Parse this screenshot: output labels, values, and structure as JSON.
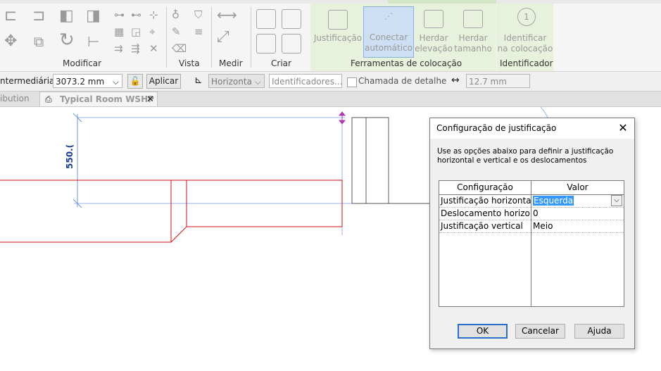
{
  "ribbon": {
    "panels": {
      "modificar": "Modificar",
      "vista": "Vista",
      "medir": "Medir",
      "criar": "Criar",
      "ferramentas": "Ferramentas de colocação",
      "identificador": "Identificador"
    },
    "buttons": {
      "justificacao": "Justificação",
      "conectar_line1": "Conectar",
      "conectar_line2": "automático",
      "herdar_elev_line1": "Herdar",
      "herdar_elev_line2": "elevação",
      "herdar_tam_line1": "Herdar",
      "herdar_tam_line2": "tamanho",
      "identificar_line1": "Identificar",
      "identificar_line2": "na colocação"
    }
  },
  "optbar": {
    "intermediaria_label": "ntermediária:",
    "intermediaria_value": "3073.2 mm",
    "aplicar": "Aplicar",
    "orientation_value": "Horizonta",
    "identificadores_placeholder": "Identificadores...",
    "chamada_label": "Chamada de detalhe",
    "offset_value": "12.7 mm"
  },
  "tabs": {
    "prev_tab": "ibution",
    "active_tab": "Typical Room WSHP"
  },
  "canvas": {
    "dimension_label": "550.("
  },
  "dialog": {
    "title": "Configuração de justificação",
    "description": "Use as opções abaixo para definir a justificação horizontal e vertical e os deslocamentos",
    "grid": {
      "col_config": "Configuração",
      "col_valor": "Valor",
      "rows": [
        {
          "config": "Justificação horizontal",
          "valor": "Esquerda"
        },
        {
          "config": "Deslocamento horizon",
          "valor": "0"
        },
        {
          "config": "Justificação vertical",
          "valor": "Meio"
        }
      ]
    },
    "buttons": {
      "ok": "OK",
      "cancelar": "Cancelar",
      "ajuda": "Ajuda"
    }
  },
  "colors": {
    "accent_blue": "#2a6fc9",
    "selection_blue": "#3399ff",
    "duct_red": "#d01010",
    "ribbon_green": "#e7f1dc"
  }
}
